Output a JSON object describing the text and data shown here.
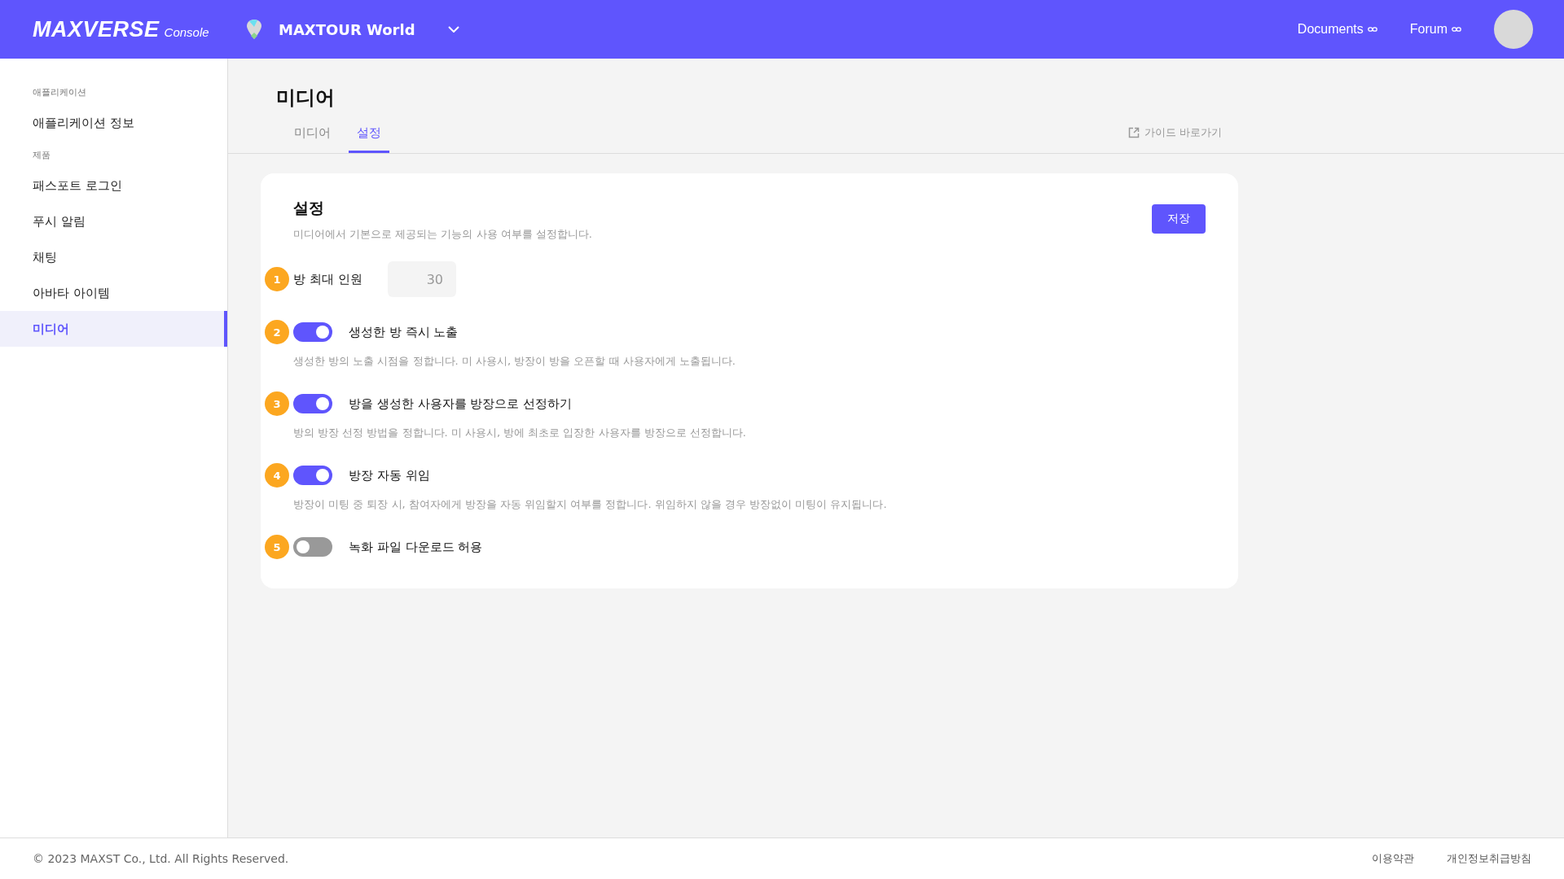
{
  "header": {
    "logo": "MAXVERSE",
    "logo_suffix": "Console",
    "project": "MAXTOUR World",
    "links": [
      {
        "label": "Documents"
      },
      {
        "label": "Forum"
      }
    ]
  },
  "sidebar": {
    "groups": [
      {
        "title": "애플리케이션",
        "items": [
          {
            "label": "애플리케이션 정보",
            "selected": false
          }
        ]
      },
      {
        "title": "제품",
        "items": [
          {
            "label": "패스포트 로그인",
            "selected": false
          },
          {
            "label": "푸시 알림",
            "selected": false
          },
          {
            "label": "채팅",
            "selected": false
          },
          {
            "label": "아바타 아이템",
            "selected": false
          },
          {
            "label": "미디어",
            "selected": true
          }
        ]
      }
    ]
  },
  "page": {
    "title": "미디어",
    "tabs": [
      {
        "label": "미디어",
        "selected": false
      },
      {
        "label": "설정",
        "selected": true
      }
    ],
    "guide_link": "가이드 바로가기"
  },
  "card": {
    "title": "설정",
    "subtitle": "미디어에서 기본으로 제공되는 기능의 사용 여부를 설정합니다.",
    "save_button": "저장",
    "settings": [
      {
        "kind": "number",
        "number": "1",
        "label": "방 최대 인원",
        "value": "30"
      },
      {
        "kind": "toggle",
        "number": "2",
        "label": "생성한 방 즉시 노출",
        "on": true,
        "description": "생성한 방의 노출 시점을 정합니다. 미 사용시, 방장이 방을 오픈할 때 사용자에게 노출됩니다."
      },
      {
        "kind": "toggle",
        "number": "3",
        "label": "방을 생성한 사용자를 방장으로 선정하기",
        "on": true,
        "description": "방의 방장 선정 방법을 정합니다. 미 사용시, 방에 최초로 입장한 사용자를 방장으로 선정합니다."
      },
      {
        "kind": "toggle",
        "number": "4",
        "label": "방장 자동 위임",
        "on": true,
        "description": "방장이 미팅 중 퇴장 시, 참여자에게 방장을 자동 위임할지 여부를 정합니다. 위임하지 않을 경우 방장없이 미팅이 유지됩니다."
      },
      {
        "kind": "toggle",
        "number": "5",
        "label": "녹화 파일 다운로드 허용",
        "on": false
      }
    ]
  },
  "footer": {
    "copyright": "© 2023 MAXST Co., Ltd. All Rights Reserved.",
    "links": [
      "이용약관",
      "개인정보취급방침"
    ]
  }
}
